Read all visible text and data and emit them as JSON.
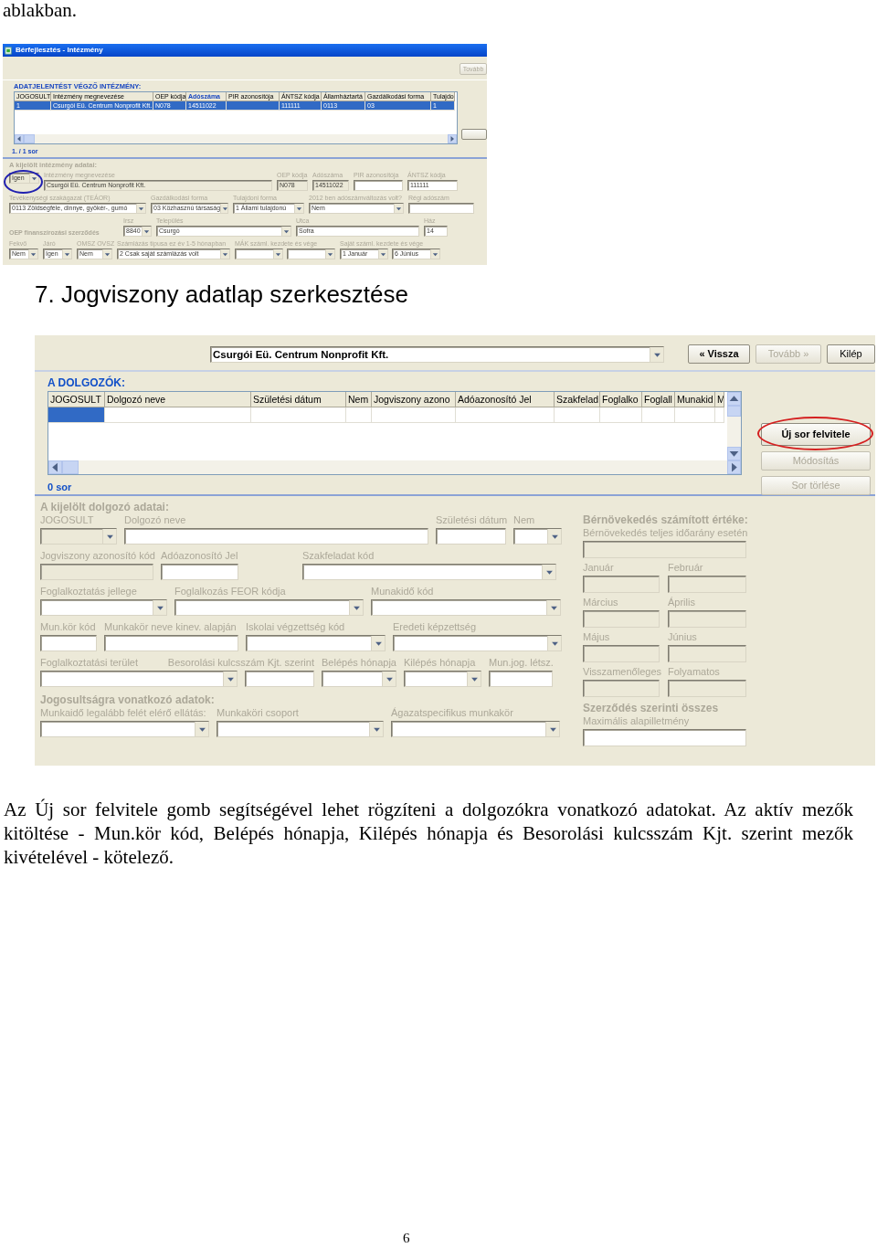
{
  "intro_text": "ablakban.",
  "screenshot_1": {
    "window_title": "Bérfejlesztés - Intézmény",
    "toolbar_buttons": [
      {
        "label": "Tovább",
        "disabled": true
      }
    ],
    "section_title": "ADATJELENTÉST VÉGZŐ INTÉZMÉNY:",
    "table": {
      "columns": [
        {
          "label": "JOGOSULT",
          "sorted": false
        },
        {
          "label": "Intézmény megnevezése",
          "sorted": false
        },
        {
          "label": "OEP kódja",
          "sorted": false
        },
        {
          "label": "Adószáma",
          "sorted": true
        },
        {
          "label": "PIR azonosítója",
          "sorted": false
        },
        {
          "label": "ÁNTSZ kódja",
          "sorted": false
        },
        {
          "label": "Államháztartá",
          "sorted": false
        },
        {
          "label": "Gazdálkodási forma",
          "sorted": false
        },
        {
          "label": "Tulajdo",
          "sorted": false
        }
      ],
      "rows": [
        {
          "selected": true,
          "cells": [
            "1",
            "Csurgói Eü. Centrum Nonprofit Kft.",
            "N078",
            "14511022",
            null,
            "111111",
            "0113",
            "03",
            "1"
          ]
        }
      ]
    },
    "row_count": "1. / 1 sor",
    "detail_title": "A kijelölt intézmény adatai:",
    "form_rows": [
      {
        "kind": "fields",
        "fields": [
          {
            "kind": "select",
            "value": "Igen",
            "disabled": true,
            "circled": true
          },
          {
            "kind": "text",
            "label": "Intézmény megnevezése",
            "value": "Csurgói Eü. Centrum Nonprofit Kft.",
            "disabled": true
          },
          {
            "kind": "text",
            "label": "OEP kódja",
            "value": "N078",
            "disabled": true
          },
          {
            "kind": "text",
            "label": "Adószáma",
            "value": "14511022",
            "disabled": true
          },
          {
            "kind": "text",
            "label": "PIR azonosítója",
            "disabled": false
          },
          {
            "kind": "text",
            "label": "ÁNTSZ kódja",
            "value": "111111",
            "disabled": false
          }
        ]
      },
      {
        "kind": "fields",
        "fields": [
          {
            "kind": "select",
            "label": "Tevékenységi szakágazat (TEÁOR)",
            "value": "0113 Zöldségféle, dinnye, gyökér-, gumó",
            "disabled": false
          },
          {
            "kind": "select",
            "label": "Gazdálkodási forma",
            "value": "03 Közhasznú társaság",
            "disabled": false
          },
          {
            "kind": "select",
            "label": "Tulajdoni forma",
            "value": "1 Állami tulajdonú",
            "disabled": false
          },
          {
            "kind": "select",
            "label": "2012 ben adószámváltozás volt?",
            "value": "Nem",
            "disabled": false
          },
          {
            "kind": "text",
            "label": "Régi adószám",
            "disabled": false
          }
        ]
      },
      {
        "kind": "fields",
        "fields": [
          {
            "kind": "heading",
            "label": "OEP finanszírozási szerződés"
          },
          {
            "kind": "select",
            "label": "Irsz",
            "value": "8840",
            "disabled": false
          },
          {
            "kind": "select",
            "label": "Település",
            "value": "Csurgó",
            "disabled": false
          },
          {
            "kind": "text",
            "label": "Utca",
            "value": "Sofra",
            "disabled": false
          },
          {
            "kind": "text",
            "label": "Ház",
            "value": "14",
            "disabled": false
          }
        ]
      },
      {
        "kind": "fields",
        "fields": [
          {
            "kind": "select",
            "label": "Fekvő",
            "value": "Nem",
            "disabled": false
          },
          {
            "kind": "select",
            "label": "Járó",
            "value": "Igen",
            "disabled": false
          },
          {
            "kind": "select",
            "label": "OMSZ OVSZ",
            "value": "Nem",
            "disabled": false
          },
          {
            "kind": "select",
            "label": "Számlázás típusa ez év 1-5 hónapban",
            "value": "2 Csak saját számlázás volt",
            "disabled": false
          },
          {
            "kind": "range",
            "label": "MÁK száml. kezdete és vége",
            "disabled": false
          },
          {
            "kind": "range",
            "label": "Saját száml. kezdete és vége",
            "from": "1 Január",
            "to": "6 Június",
            "disabled": false
          }
        ]
      }
    ]
  },
  "heading": "7. Jogviszony adatlap szerkesztése",
  "screenshot_2": {
    "institution_select": {
      "value": "Csurgói Eü. Centrum Nonprofit Kft."
    },
    "nav_buttons": [
      {
        "label": "« Vissza",
        "disabled": false,
        "default": true
      },
      {
        "label": "Tovább »",
        "disabled": true,
        "default": false
      },
      {
        "label": "Kilép",
        "disabled": false,
        "default": false
      }
    ],
    "section_title": "A DOLGOZÓK:",
    "table": {
      "columns": [
        {
          "label": "JOGOSULT"
        },
        {
          "label": "Dolgozó neve"
        },
        {
          "label": "Születési dátum"
        },
        {
          "label": "Nem"
        },
        {
          "label": "Jogviszony azono"
        },
        {
          "label": "Adóazonosító Jel"
        },
        {
          "label": "Szakfelad"
        },
        {
          "label": "Foglalko"
        },
        {
          "label": "Foglall"
        },
        {
          "label": "Munakid"
        },
        {
          "label": "M"
        }
      ],
      "rows": [
        {
          "selected": true
        }
      ]
    },
    "row_count": "0 sor",
    "action_buttons": [
      {
        "label": "Új sor felvitele",
        "disabled": false,
        "circled": true
      },
      {
        "label": "Módosítás",
        "disabled": true,
        "circled": false
      },
      {
        "label": "Sor törlése",
        "disabled": true,
        "circled": false
      }
    ],
    "form_rows": [
      {
        "kind": "heading",
        "text": "A kijelölt dolgozó adatai:"
      },
      {
        "kind": "fields",
        "fields": [
          {
            "kind": "select",
            "label": "JOGOSULT",
            "disabled": true
          },
          {
            "kind": "text",
            "label": "Dolgozó neve",
            "disabled": false
          },
          {
            "kind": "text",
            "label": "Születési dátum",
            "disabled": false
          },
          {
            "kind": "select",
            "label": "Nem",
            "disabled": false
          }
        ]
      },
      {
        "kind": "fields",
        "fields": [
          {
            "kind": "text",
            "label": "Jogviszony azonosító kód",
            "disabled": true
          },
          {
            "kind": "text",
            "label": "Adóazonosító Jel",
            "disabled": false
          },
          {
            "kind": "select",
            "label": "Szakfeladat kód",
            "disabled": false
          }
        ]
      },
      {
        "kind": "fields",
        "fields": [
          {
            "kind": "select",
            "label": "Foglalkoztatás jellege",
            "disabled": false
          },
          {
            "kind": "select",
            "label": "Foglalkozás FEOR kódja",
            "disabled": false
          },
          {
            "kind": "select",
            "label": "Munakidő kód",
            "disabled": false
          }
        ]
      },
      {
        "kind": "fields",
        "fields": [
          {
            "kind": "text",
            "label": "Mun.kör kód",
            "disabled": false
          },
          {
            "kind": "text",
            "label": "Munkakör neve kinev. alapján",
            "disabled": false
          },
          {
            "kind": "select",
            "label": "Iskolai végzettség kód",
            "disabled": false
          },
          {
            "kind": "select",
            "label": "Eredeti képzettség",
            "disabled": false
          }
        ]
      },
      {
        "kind": "fields",
        "fields": [
          {
            "kind": "select",
            "label": "Foglalkoztatási terület",
            "disabled": false
          },
          {
            "kind": "text",
            "label": "Besorolási kulcsszám Kjt. szerint",
            "disabled": false
          },
          {
            "kind": "select",
            "label": "Belépés hónapja",
            "disabled": false
          },
          {
            "kind": "select",
            "label": "Kilépés hónapja",
            "disabled": false
          },
          {
            "kind": "text",
            "label": "Mun.jog. létsz.",
            "disabled": false
          }
        ]
      },
      {
        "kind": "heading",
        "text": "Jogosultságra vonatkozó adatok:"
      },
      {
        "kind": "fields",
        "fields": [
          {
            "kind": "select",
            "label": "Munkaidő legalább felét elérő ellátás:",
            "disabled": false
          },
          {
            "kind": "select",
            "label": "Munkaköri csoport",
            "disabled": false
          },
          {
            "kind": "select",
            "label": "Ágazatspecifikus munkakör",
            "disabled": false
          }
        ]
      }
    ],
    "side_rows": [
      {
        "kind": "heading",
        "text": "Bérnövekedés számított értéke:"
      },
      {
        "kind": "fields",
        "fields": [
          {
            "kind": "text",
            "label": "Bérnövekedés teljes időarány esetén",
            "disabled": true
          }
        ]
      },
      {
        "kind": "fields",
        "fields": [
          {
            "kind": "text",
            "label": "Január",
            "disabled": true
          },
          {
            "kind": "text",
            "label": "Február",
            "disabled": true
          }
        ]
      },
      {
        "kind": "fields",
        "fields": [
          {
            "kind": "text",
            "label": "Március",
            "disabled": true
          },
          {
            "kind": "text",
            "label": "Április",
            "disabled": true
          }
        ]
      },
      {
        "kind": "fields",
        "fields": [
          {
            "kind": "text",
            "label": "Május",
            "disabled": true
          },
          {
            "kind": "text",
            "label": "Június",
            "disabled": true
          }
        ]
      },
      {
        "kind": "fields",
        "fields": [
          {
            "kind": "text",
            "label": "Visszamenőleges",
            "disabled": true
          },
          {
            "kind": "text",
            "label": "Folyamatos",
            "disabled": true
          }
        ]
      },
      {
        "kind": "heading",
        "text": "Szerződés szerinti összes"
      },
      {
        "kind": "fields",
        "fields": [
          {
            "kind": "text",
            "label": "Maximális alapilletmény",
            "disabled": false
          }
        ]
      }
    ]
  },
  "paragraph": "Az Új sor felvitele gomb segítségével lehet rögzíteni a dolgozókra vonatkozó adatokat. Az aktív mezők kitöltése - Mun.kör kód, Belépés hónapja, Kilépés hónapja és Besorolási kulcsszám Kjt. szerint mezők kivételével - kötelező.",
  "page_number": "6"
}
